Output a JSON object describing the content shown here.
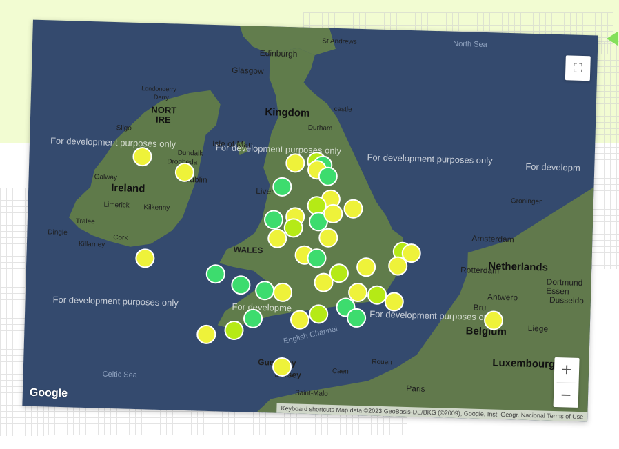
{
  "map": {
    "dev_notice": "For development purposes only",
    "dev_notices": [
      {
        "text": "For development purposes only"
      },
      {
        "text": "For development purposes only"
      },
      {
        "text": "For developm"
      },
      {
        "text": "For development purposes only"
      },
      {
        "text": "For development purposes only"
      },
      {
        "text": "For development purposes only"
      },
      {
        "text": "For developme"
      }
    ],
    "places": [
      {
        "name": "St Andrews"
      },
      {
        "name": "Edinburgh"
      },
      {
        "name": "Glasgow"
      },
      {
        "name": "Londonderry"
      },
      {
        "name": "Derry"
      },
      {
        "name": "NORT"
      },
      {
        "name": "IRE"
      },
      {
        "name": "Sligo"
      },
      {
        "name": "Kingdom"
      },
      {
        "name": "Isle of Man"
      },
      {
        "name": "Dundalk"
      },
      {
        "name": "Drogheda"
      },
      {
        "name": "Dublin"
      },
      {
        "name": "Ireland"
      },
      {
        "name": "Galway"
      },
      {
        "name": "Limerick"
      },
      {
        "name": "Kilkenny"
      },
      {
        "name": "Tralee"
      },
      {
        "name": "Dingle"
      },
      {
        "name": "Cork"
      },
      {
        "name": "Killarney"
      },
      {
        "name": "Liver"
      },
      {
        "name": "WALES"
      },
      {
        "name": "Durham"
      },
      {
        "name": "castle"
      },
      {
        "name": "Amsterdam"
      },
      {
        "name": "Netherlands"
      },
      {
        "name": "Rotterdam"
      },
      {
        "name": "Groningen"
      },
      {
        "name": "Dortmund"
      },
      {
        "name": "Essen"
      },
      {
        "name": "Dusseldo"
      },
      {
        "name": "Antwerp"
      },
      {
        "name": "Bru"
      },
      {
        "name": "Belgium"
      },
      {
        "name": "Liege"
      },
      {
        "name": "Luxembourg"
      },
      {
        "name": "Guernsey"
      },
      {
        "name": "Jersey"
      },
      {
        "name": "Caen"
      },
      {
        "name": "Rouen"
      },
      {
        "name": "Paris"
      },
      {
        "name": "Saint-Malo"
      },
      {
        "name": "Celtic Sea"
      },
      {
        "name": "English Channel"
      },
      {
        "name": "North Sea"
      }
    ],
    "marker_colors": {
      "yellow": "#eef23a",
      "lime": "#b5ea16",
      "green": "#3ddc6e"
    },
    "markers": [
      {
        "lat": 55.0,
        "lng": -1.6,
        "color": "#b5ea16"
      },
      {
        "lat": 54.9,
        "lng": -1.4,
        "color": "#3ddc6e"
      },
      {
        "lat": 54.78,
        "lng": -1.58,
        "color": "#eef23a"
      },
      {
        "lat": 54.6,
        "lng": -1.2,
        "color": "#3ddc6e"
      },
      {
        "lat": 54.95,
        "lng": -2.3,
        "color": "#eef23a"
      },
      {
        "lat": 54.3,
        "lng": -2.7,
        "color": "#3ddc6e"
      },
      {
        "lat": 54.0,
        "lng": -1.1,
        "color": "#eef23a"
      },
      {
        "lat": 53.8,
        "lng": -1.55,
        "color": "#b5ea16"
      },
      {
        "lat": 53.75,
        "lng": -0.35,
        "color": "#eef23a"
      },
      {
        "lat": 53.5,
        "lng": -2.25,
        "color": "#eef23a"
      },
      {
        "lat": 53.4,
        "lng": -2.95,
        "color": "#3ddc6e"
      },
      {
        "lat": 53.38,
        "lng": -1.47,
        "color": "#3ddc6e"
      },
      {
        "lat": 53.6,
        "lng": -1.0,
        "color": "#eef23a"
      },
      {
        "lat": 53.2,
        "lng": -2.3,
        "color": "#b5ea16"
      },
      {
        "lat": 52.95,
        "lng": -1.15,
        "color": "#eef23a"
      },
      {
        "lat": 52.9,
        "lng": -2.8,
        "color": "#eef23a"
      },
      {
        "lat": 52.63,
        "lng": 1.3,
        "color": "#b5ea16"
      },
      {
        "lat": 52.6,
        "lng": 1.6,
        "color": "#eef23a"
      },
      {
        "lat": 52.25,
        "lng": 1.15,
        "color": "#eef23a"
      },
      {
        "lat": 52.48,
        "lng": -1.9,
        "color": "#eef23a"
      },
      {
        "lat": 52.4,
        "lng": -1.5,
        "color": "#3ddc6e"
      },
      {
        "lat": 52.2,
        "lng": 0.12,
        "color": "#eef23a"
      },
      {
        "lat": 52.0,
        "lng": -0.75,
        "color": "#b5ea16"
      },
      {
        "lat": 51.75,
        "lng": -1.25,
        "color": "#eef23a"
      },
      {
        "lat": 51.9,
        "lng": -4.8,
        "color": "#3ddc6e"
      },
      {
        "lat": 51.62,
        "lng": -3.95,
        "color": "#3ddc6e"
      },
      {
        "lat": 51.48,
        "lng": -3.18,
        "color": "#3ddc6e"
      },
      {
        "lat": 51.45,
        "lng": -2.58,
        "color": "#eef23a"
      },
      {
        "lat": 51.5,
        "lng": -0.12,
        "color": "#eef23a"
      },
      {
        "lat": 51.45,
        "lng": 0.5,
        "color": "#b5ea16"
      },
      {
        "lat": 51.28,
        "lng": 1.08,
        "color": "#eef23a"
      },
      {
        "lat": 51.1,
        "lng": -0.5,
        "color": "#3ddc6e"
      },
      {
        "lat": 50.9,
        "lng": -1.4,
        "color": "#b5ea16"
      },
      {
        "lat": 50.82,
        "lng": -0.14,
        "color": "#3ddc6e"
      },
      {
        "lat": 50.72,
        "lng": -2.0,
        "color": "#eef23a"
      },
      {
        "lat": 50.72,
        "lng": -3.53,
        "color": "#3ddc6e"
      },
      {
        "lat": 50.4,
        "lng": -4.14,
        "color": "#b5ea16"
      },
      {
        "lat": 50.26,
        "lng": -5.05,
        "color": "#eef23a"
      },
      {
        "lat": 49.45,
        "lng": -2.55,
        "color": "#eef23a"
      },
      {
        "lat": 55.0,
        "lng": -7.3,
        "color": "#eef23a"
      },
      {
        "lat": 54.6,
        "lng": -5.9,
        "color": "#eef23a"
      },
      {
        "lat": 52.26,
        "lng": -7.11,
        "color": "#eef23a"
      },
      {
        "lat": 50.85,
        "lng": 4.35,
        "color": "#eef23a"
      }
    ]
  },
  "controls": {
    "fullscreen_icon": "fullscreen-icon",
    "zoom_in": "+",
    "zoom_out": "−"
  },
  "branding": {
    "logo": "Google",
    "attribution": "Keyboard shortcuts   Map data ©2023 GeoBasis-DE/BKG (©2009), Google, Inst. Geogr. Nacional   Terms of Use"
  }
}
